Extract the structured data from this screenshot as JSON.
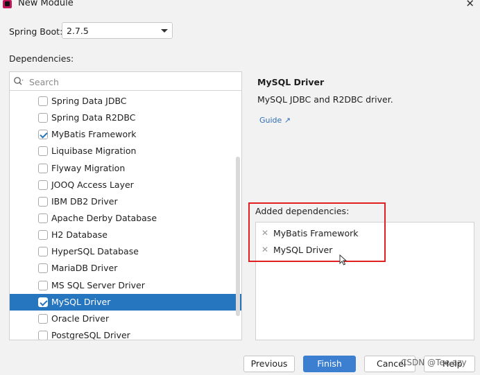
{
  "window": {
    "title": "New Module"
  },
  "spring_boot": {
    "label": "Spring Boot:",
    "value": "2.7.5"
  },
  "dependencies": {
    "label": "Dependencies:",
    "search_placeholder": "Search",
    "items": [
      {
        "label": "Spring Data JDBC",
        "checked": false,
        "selected": false
      },
      {
        "label": "Spring Data R2DBC",
        "checked": false,
        "selected": false
      },
      {
        "label": "MyBatis Framework",
        "checked": true,
        "selected": false
      },
      {
        "label": "Liquibase Migration",
        "checked": false,
        "selected": false
      },
      {
        "label": "Flyway Migration",
        "checked": false,
        "selected": false
      },
      {
        "label": "JOOQ Access Layer",
        "checked": false,
        "selected": false
      },
      {
        "label": "IBM DB2 Driver",
        "checked": false,
        "selected": false
      },
      {
        "label": "Apache Derby Database",
        "checked": false,
        "selected": false
      },
      {
        "label": "H2 Database",
        "checked": false,
        "selected": false
      },
      {
        "label": "HyperSQL Database",
        "checked": false,
        "selected": false
      },
      {
        "label": "MariaDB Driver",
        "checked": false,
        "selected": false
      },
      {
        "label": "MS SQL Server Driver",
        "checked": false,
        "selected": false
      },
      {
        "label": "MySQL Driver",
        "checked": true,
        "selected": true
      },
      {
        "label": "Oracle Driver",
        "checked": false,
        "selected": false
      },
      {
        "label": "PostgreSQL Driver",
        "checked": false,
        "selected": false
      }
    ]
  },
  "detail": {
    "title": "MySQL Driver",
    "description": "MySQL JDBC and R2DBC driver.",
    "guide_label": "Guide ↗"
  },
  "added": {
    "label": "Added dependencies:",
    "items": [
      "MyBatis Framework",
      "MySQL Driver"
    ]
  },
  "buttons": {
    "previous": "Previous",
    "finish": "Finish",
    "cancel": "Cancel",
    "help": "Help"
  },
  "watermark": "CSDN @Tee azy",
  "colors": {
    "selection": "#2675bf",
    "primary_button": "#3c7fd1",
    "highlight_box": "#e02020",
    "link": "#2f6db5"
  }
}
